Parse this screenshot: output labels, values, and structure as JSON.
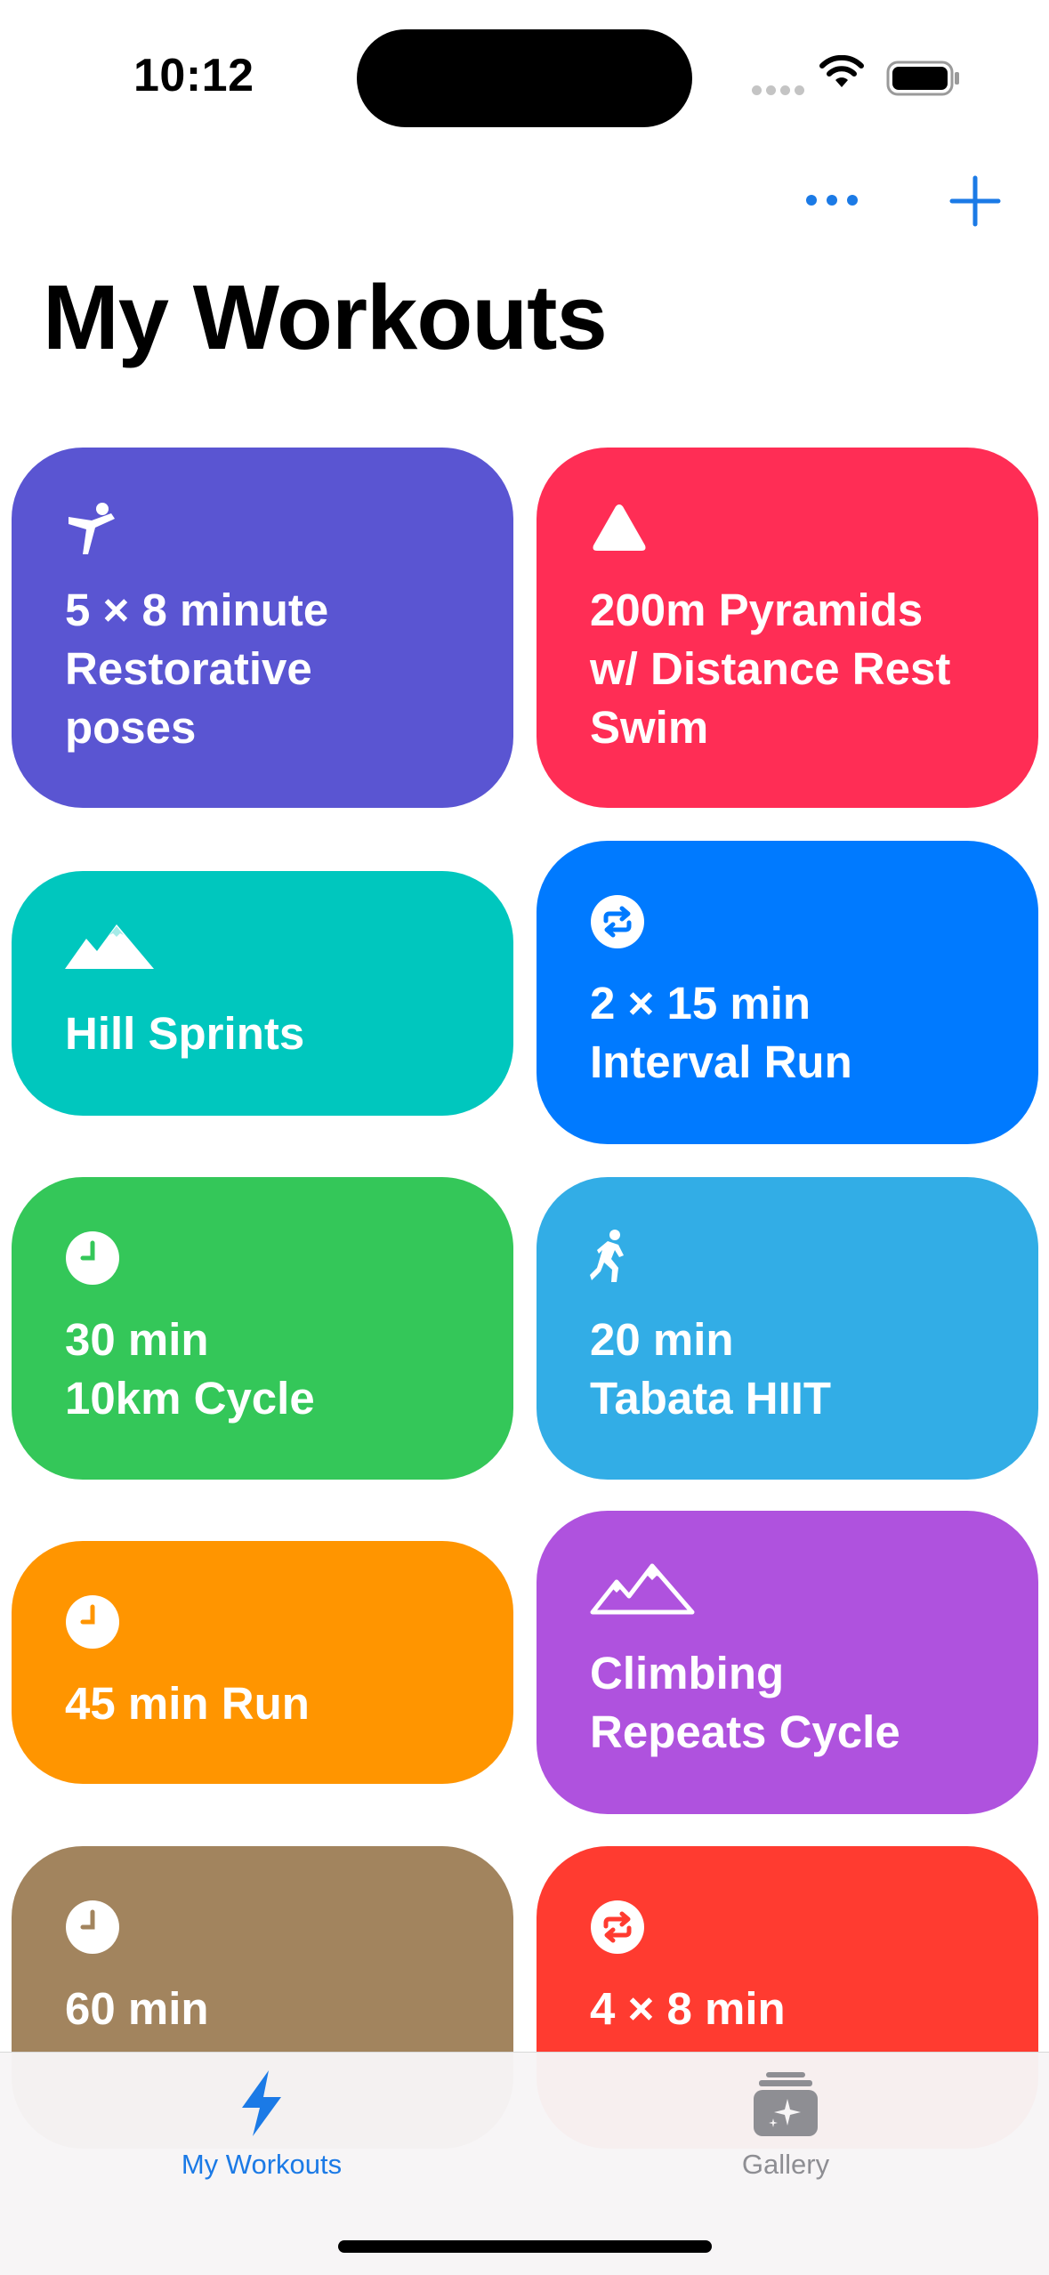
{
  "status_bar": {
    "time": "10:12"
  },
  "nav": {
    "more_icon": "ellipsis-icon",
    "add_icon": "plus-icon"
  },
  "title": "My Workouts",
  "colors": {
    "accent": "#007aff",
    "cards": [
      "#5a55d2",
      "#ff2d55",
      "#00c7be",
      "#007aff",
      "#34c759",
      "#32ade6",
      "#ff9500",
      "#af52de",
      "#a2845e",
      "#ff3b30"
    ]
  },
  "workouts": [
    {
      "icon": "yoga-icon",
      "lines": [
        "5 × 8 minute",
        "Restorative",
        "poses"
      ]
    },
    {
      "icon": "triangle-icon",
      "lines": [
        "200m Pyramids",
        "w/ Distance Rest",
        "Swim"
      ]
    },
    {
      "icon": "mountains-icon",
      "lines": [
        "Hill Sprints"
      ]
    },
    {
      "icon": "repeat-icon",
      "lines": [
        "2 × 15 min",
        "Interval Run"
      ]
    },
    {
      "icon": "clock-icon",
      "lines": [
        "30 min",
        "10km Cycle"
      ]
    },
    {
      "icon": "runner-icon",
      "lines": [
        "20 min",
        "Tabata HIIT"
      ]
    },
    {
      "icon": "clock-icon",
      "lines": [
        "45 min Run"
      ]
    },
    {
      "icon": "mountains-outline-icon",
      "lines": [
        "Climbing",
        "Repeats Cycle"
      ]
    },
    {
      "icon": "clock-icon",
      "lines": [
        "60 min"
      ]
    },
    {
      "icon": "repeat-icon",
      "lines": [
        "4 × 8 min"
      ]
    }
  ],
  "tabbar": {
    "items": [
      {
        "label": "My Workouts",
        "icon": "bolt-icon",
        "selected": true
      },
      {
        "label": "Gallery",
        "icon": "gallery-stack-icon",
        "selected": false
      }
    ]
  }
}
